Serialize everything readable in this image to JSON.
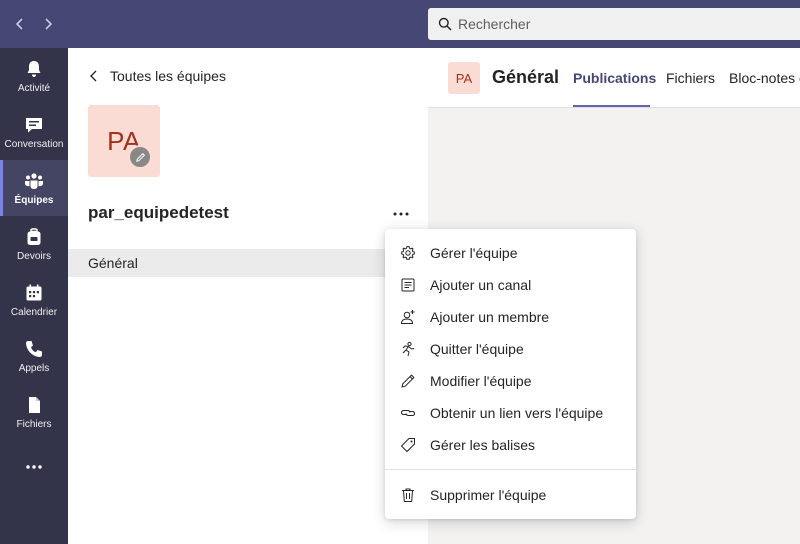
{
  "topbar": {
    "back_icon": "chevron-left-icon",
    "forward_icon": "chevron-right-icon",
    "search_placeholder": "Rechercher"
  },
  "rail": {
    "items": [
      {
        "label": "Activité",
        "icon": "bell-icon"
      },
      {
        "label": "Conversation",
        "icon": "chat-icon"
      },
      {
        "label": "Équipes",
        "icon": "teams-icon",
        "active": true
      },
      {
        "label": "Devoirs",
        "icon": "backpack-icon"
      },
      {
        "label": "Calendrier",
        "icon": "calendar-icon"
      },
      {
        "label": "Appels",
        "icon": "phone-icon"
      },
      {
        "label": "Fichiers",
        "icon": "file-icon"
      }
    ],
    "more_icon": "more-horizontal-icon"
  },
  "team_panel": {
    "back_label": "Toutes les équipes",
    "avatar_initials": "PA",
    "team_name": "par_equipedetest",
    "channels": [
      {
        "label": "Général"
      }
    ]
  },
  "channel_header": {
    "avatar_initials": "PA",
    "title": "Général",
    "tabs": [
      {
        "label": "Publications",
        "active": true
      },
      {
        "label": "Fichiers"
      },
      {
        "label": "Bloc-notes c"
      }
    ]
  },
  "context_menu": {
    "items": [
      {
        "label": "Gérer l'équipe",
        "icon": "gear-icon"
      },
      {
        "label": "Ajouter un canal",
        "icon": "add-channel-icon"
      },
      {
        "label": "Ajouter un membre",
        "icon": "add-member-icon"
      },
      {
        "label": "Quitter l'équipe",
        "icon": "leave-icon"
      },
      {
        "label": "Modifier l'équipe",
        "icon": "pencil-icon"
      },
      {
        "label": "Obtenir un lien vers l'équipe",
        "icon": "link-icon"
      },
      {
        "label": "Gérer les balises",
        "icon": "tag-icon"
      }
    ],
    "delete_item": {
      "label": "Supprimer l'équipe",
      "icon": "trash-icon"
    }
  },
  "colors": {
    "topbar": "#464775",
    "rail": "#33344a",
    "accent": "#6264a7",
    "avatar_bg": "#fbdcd5",
    "avatar_text": "#a1321d"
  }
}
